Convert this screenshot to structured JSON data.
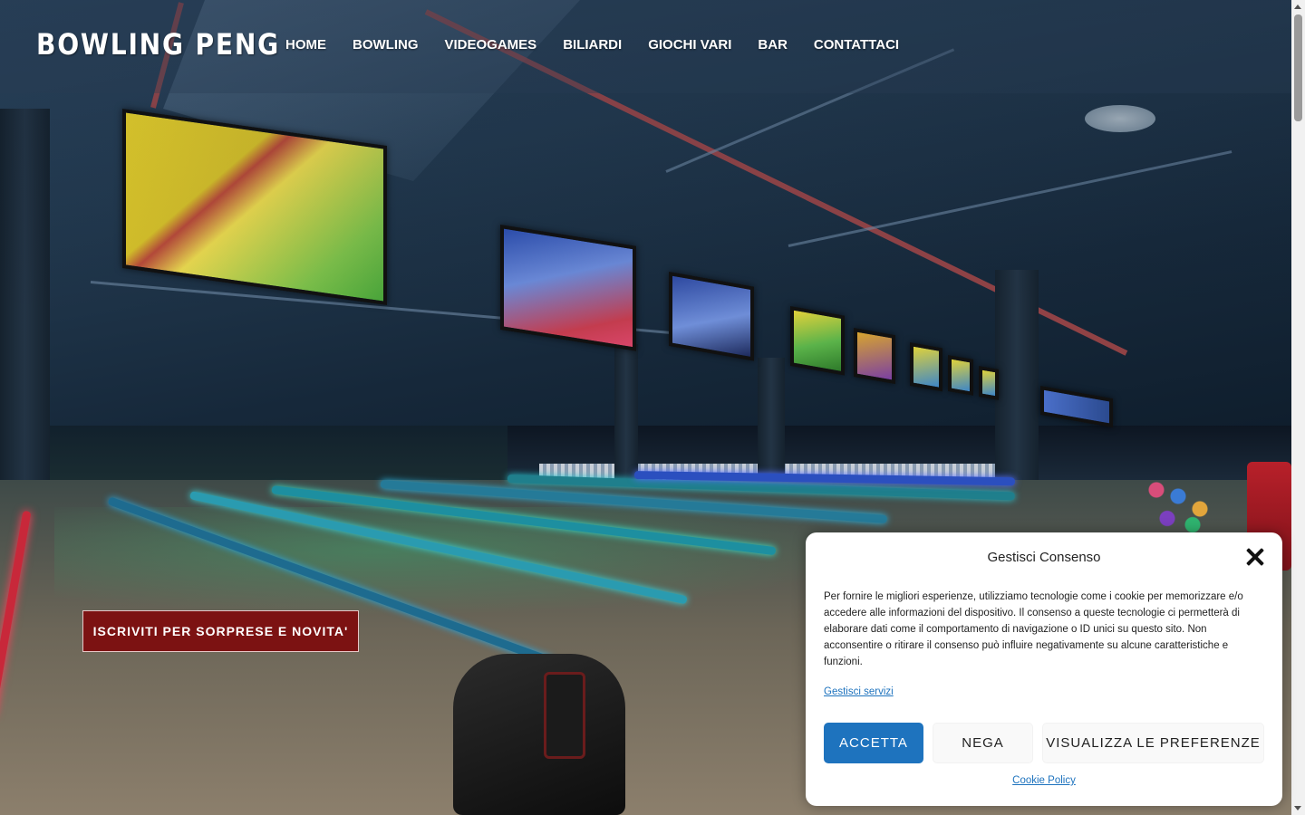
{
  "header": {
    "logo": "BOWLING PENG",
    "nav": [
      "HOME",
      "BOWLING",
      "VIDEOGAMES",
      "BILIARDI",
      "GIOCHI VARI",
      "BAR",
      "CONTATTACI"
    ]
  },
  "hero": {
    "cta_label": "ISCRIVITI PER SORPRESE E NOVITA'"
  },
  "consent": {
    "title": "Gestisci Consenso",
    "text": "Per fornire le migliori esperienze, utilizziamo tecnologie come i cookie per memorizzare e/o accedere alle informazioni del dispositivo. Il consenso a queste tecnologie ci permetterà di elaborare dati come il comportamento di navigazione o ID unici su questo sito. Non acconsentire o ritirare il consenso può influire negativamente su alcune caratteristiche e funzioni.",
    "services_link": "Gestisci servizi",
    "accept_label": "ACCETTA",
    "deny_label": "NEGA",
    "preferences_label": "VISUALIZZA LE PREFERENZE",
    "policy_link": "Cookie Policy"
  },
  "colors": {
    "cta_bg": "#7c1212",
    "accent": "#1e73be"
  },
  "icons": {
    "close": "close-icon"
  }
}
